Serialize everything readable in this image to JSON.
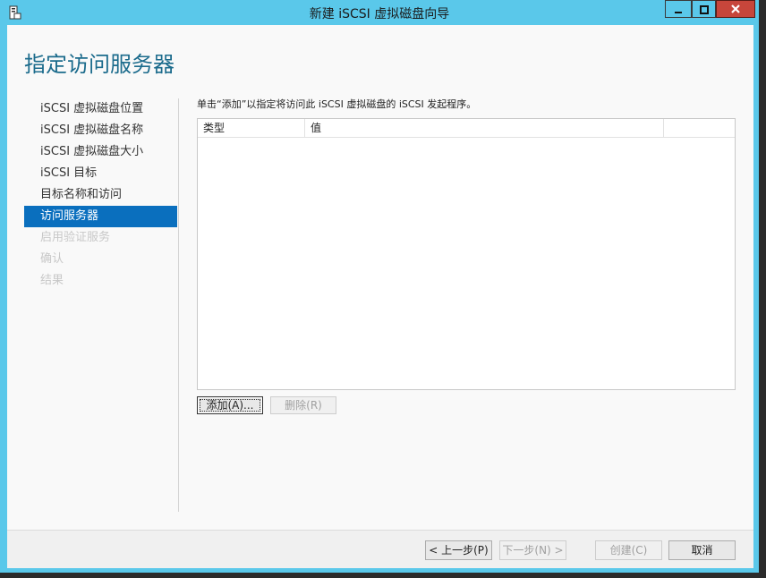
{
  "window": {
    "title": "新建 iSCSI 虚拟磁盘向导",
    "icons": {
      "app": "server-manager-icon",
      "minimize": "minimize-icon",
      "maximize": "maximize-icon",
      "close": "close-icon"
    }
  },
  "page_title": "指定访问服务器",
  "steps": [
    {
      "label": "iSCSI 虚拟磁盘位置",
      "state": "done"
    },
    {
      "label": "iSCSI 虚拟磁盘名称",
      "state": "done"
    },
    {
      "label": "iSCSI 虚拟磁盘大小",
      "state": "done"
    },
    {
      "label": "iSCSI 目标",
      "state": "done"
    },
    {
      "label": "目标名称和访问",
      "state": "done"
    },
    {
      "label": "访问服务器",
      "state": "active"
    },
    {
      "label": "启用验证服务",
      "state": "disabled"
    },
    {
      "label": "确认",
      "state": "disabled"
    },
    {
      "label": "结果",
      "state": "disabled"
    }
  ],
  "instruction": "单击“添加”以指定将访问此 iSCSI 虚拟磁盘的 iSCSI 发起程序。",
  "table": {
    "columns": [
      "类型",
      "值",
      ""
    ],
    "rows": []
  },
  "buttons": {
    "add": "添加(A)...",
    "remove": "删除(R)"
  },
  "footer": {
    "prev": "< 上一步(P)",
    "next": "下一步(N) >",
    "create": "创建(C)",
    "cancel": "取消"
  },
  "colors": {
    "titlebar": "#5ac8ea",
    "accent": "#0a6fbe",
    "title_text": "#1b6b8c",
    "close": "#c7463b"
  }
}
